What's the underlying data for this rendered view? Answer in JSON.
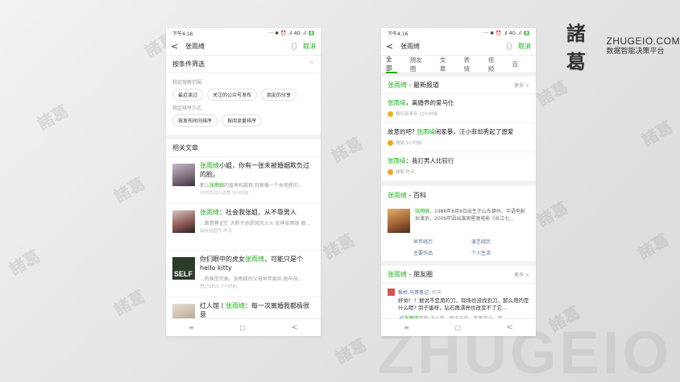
{
  "brand": {
    "logo": "諸葛",
    "name": "ZHUGEIO.COM",
    "tagline": "数据智能决策平台"
  },
  "watermarks": {
    "small": "諸葛",
    "big": "ZHUGEIO"
  },
  "status": {
    "time": "下午4:16",
    "icons": "··· ✱ ⏰ .ıl 4G .ıl",
    "battery": "▮"
  },
  "left": {
    "search": {
      "back": "<",
      "query": "张雨绮",
      "cancel": "取消"
    },
    "filter": {
      "title": "按条件筛选",
      "caret": "^",
      "scope_label": "指定搜索范围",
      "scope_chips": [
        "最近读过",
        "关注的公众号发布",
        "朋友的分享"
      ],
      "sort_label": "指定排序方式",
      "sort_chips": [
        "按发布时间排序",
        "按阅读量排序"
      ]
    },
    "section_title": "相关文章",
    "articles": [
      {
        "hl": "张雨绮",
        "title": "小姐，你有一张未被婚姻欺负过的脸。",
        "snippet_pre": "那么",
        "snippet_hl": "张雨绮",
        "snippet_post": "的直率和飒爽,则更像一个女明星的...",
        "meta": "与尔同消万古愁  3小时前"
      },
      {
        "pre": "",
        "hl": "张雨绮",
        "title": "：社会我张姐，从不靠男人",
        "snippet": "...致青春记忆 大胖子总是风风火火 女神张雨绮 敢爱敢恨的性格也算是一枚典型的狮子女 中国",
        "meta": "晨枝拾园号  昨天"
      },
      {
        "pre": "你们眼中的虎女",
        "hl": "张雨绮",
        "title": "，可能只是个hello kitty",
        "thumb_text": "SELF",
        "snippet": "...的典型代表。张雨绮的父母早年离异,她与母...",
        "meta": "悦己SELF  7小时前"
      },
      {
        "pre": "红人馆丨",
        "hl": "张雨绮",
        "title": "：每一次离婚我都极很意",
        "snippet": "",
        "meta": ""
      }
    ]
  },
  "right": {
    "search": {
      "back": "<",
      "query": "张雨绮",
      "cancel": "取消"
    },
    "tabs": [
      "全部",
      "朋友圈",
      "文章",
      "表情",
      "视频",
      "百"
    ],
    "news": {
      "hl": "张雨绮",
      "title": " - 最新报道",
      "more": "更多 >",
      "items": [
        {
          "hl": "张雨绮",
          "text": "，离婚界的爱马仕",
          "source": "娱乐新青年  12小时前"
        },
        {
          "pre": "故意的吧? ",
          "hl": "张雨绮",
          "text": "闹家暴，汪小菲却秀起了恩爱",
          "source": "搜狐  5小时前"
        },
        {
          "hl": "张雨绮",
          "text": "：我打男人比较行",
          "source": "搜狐  昨天"
        }
      ]
    },
    "baike": {
      "hl": "张雨绮",
      "title": " - 百科",
      "text_hl": "张雨绮",
      "text": "，1986年8月8日出生于山东德州，华语电影女演员，2006年因出演周星驰电影《长江七...",
      "links": [
        "早年经历",
        "演艺经历",
        "主要作品",
        "个人生活"
      ]
    },
    "moments": {
      "hl": "张雨绮",
      "title": " - 朋友圈",
      "more": "更多 >",
      "author": "枫桥-鸟哥笔记",
      "time": "昨天",
      "text": "好帅！！据说不是用的刀，现场也没找到刀，那么用的是什么呢? 鸽子蛋呀，钻石再漂亮也改变不了它...",
      "link_hl": "张雨绮",
      "link": "离婚:汪小菲，颜王全安，钦宴巴元，我..."
    }
  },
  "nav": {
    "menu": "≡",
    "home": "□",
    "back": "<"
  }
}
